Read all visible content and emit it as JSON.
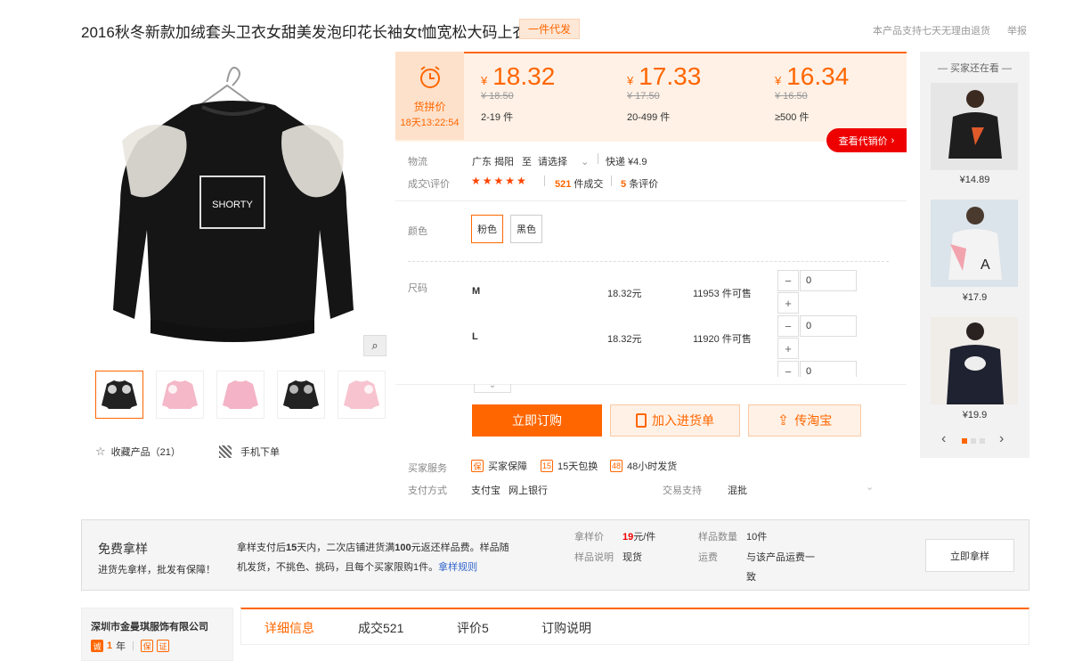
{
  "product": {
    "title": "2016秋冬新款加绒套头卫衣女甜美发泡印花长袖女t恤宽松大码上衣",
    "badge": "一件代发",
    "return_policy": "本产品支持七天无理由退货",
    "report": "举报"
  },
  "gallery": {
    "zoom_icon": "magnifier-icon",
    "thumbnails": [
      {
        "color": "#222222",
        "print": "#ffffff"
      },
      {
        "color": "#f4b8c8",
        "print": "#ffffff"
      },
      {
        "color": "#f4b3c6",
        "print": "#f7d2dc"
      },
      {
        "color": "#222222",
        "print": "#dddddd"
      },
      {
        "color": "#f7c3cf",
        "print": "#ffffff"
      }
    ],
    "favorite_label": "收藏产品（21）",
    "mobile_label": "手机下单"
  },
  "pricing": {
    "pin_label": "货拼价",
    "pin_time": "18天13:22:54",
    "currency": "¥",
    "tiers": [
      {
        "price": "18.32",
        "original": "¥ 18.50",
        "qty": "2-19 件"
      },
      {
        "price": "17.33",
        "original": "¥ 17.50",
        "qty": "20-499 件"
      },
      {
        "price": "16.34",
        "original": "¥ 16.50",
        "qty": "≥500 件"
      }
    ],
    "agent_price_btn": "查看代销价"
  },
  "logistics": {
    "label": "物流",
    "from": "广东 揭阳",
    "to_word": "至",
    "select": "请选择",
    "express": "快递 ¥4.9"
  },
  "trade": {
    "label": "成交\\评价",
    "stars": "★★★★★",
    "deals_num": "521",
    "deals_text": "件成交",
    "reviews_num": "5",
    "reviews_text": "条评价"
  },
  "color": {
    "label": "颜色",
    "options": [
      "粉色",
      "黑色"
    ]
  },
  "size": {
    "label": "尺码",
    "rows": [
      {
        "name": "M",
        "price": "18.32元",
        "stock": "11953 件可售",
        "qty": "0"
      },
      {
        "name": "L",
        "price": "18.32元",
        "stock": "11920 件可售",
        "qty": "0"
      },
      {
        "name": "",
        "price": "",
        "stock": "",
        "qty": "0"
      }
    ]
  },
  "actions": {
    "order": "立即订购",
    "add_cart": "加入进货单",
    "taobao": "传淘宝"
  },
  "service": {
    "label": "买家服务",
    "items": [
      "买家保障",
      "15天包换",
      "48小时发货"
    ],
    "pay_label": "支付方式",
    "pay_methods": [
      "支付宝",
      "网上银行"
    ],
    "trade_label": "交易支持",
    "trade_value": "混批"
  },
  "side_panel": {
    "header": "买家还在看",
    "items": [
      {
        "price": "¥14.89",
        "color": "#1e1e1e"
      },
      {
        "price": "¥17.9",
        "color": "#f0f0f0"
      },
      {
        "price": "¥19.9",
        "color": "#1f2230"
      }
    ]
  },
  "sample": {
    "title": "免费拿样",
    "subtitle": "进货先拿样，批发有保障！",
    "desc_a": "拿样支付后",
    "desc_b": "15",
    "desc_c": "天内，二次店铺进货满",
    "desc_d": "100",
    "desc_e": "元返还样品费。样品随",
    "desc_line2": "机发货，不挑色、挑码，且每个买家限购1件。",
    "rule_link": "拿样规则",
    "price_label": "拿样价",
    "price_value": "19",
    "price_unit": "元/件",
    "desc_label": "样品说明",
    "desc_value": "现货",
    "count_label": "样品数量",
    "count_value": "10件",
    "freight_label": "运费",
    "freight_value_1": "与该产品运费一",
    "freight_value_2": "致",
    "button": "立即拿样"
  },
  "company": {
    "name": "深圳市金曼琪服饰有限公司",
    "years_num": "1",
    "years_unit": "年"
  },
  "tabs": [
    "详细信息",
    "成交521",
    "评价5",
    "订购说明"
  ]
}
